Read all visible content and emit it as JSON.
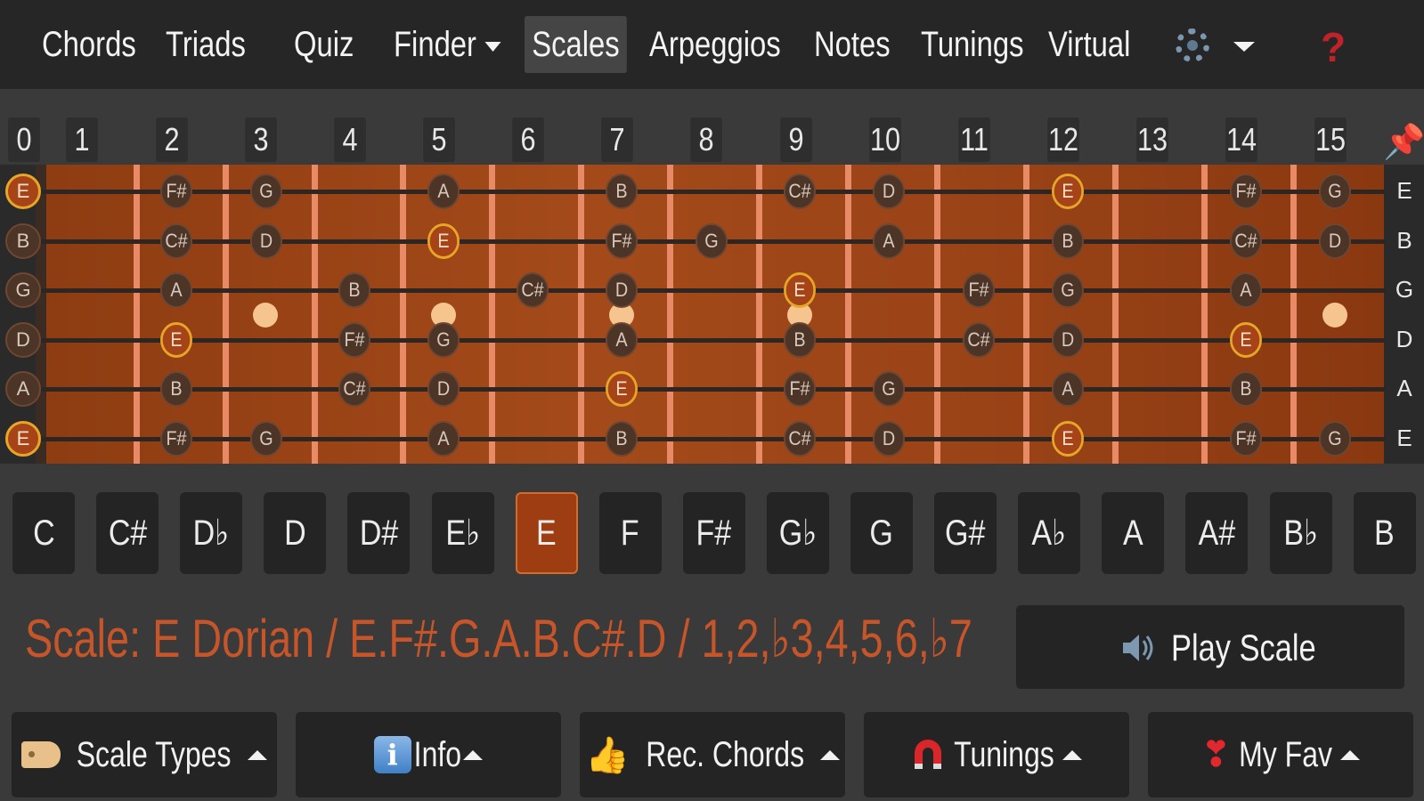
{
  "nav": {
    "items": [
      "Chords",
      "Triads",
      "Quiz",
      "Finder",
      "Scales",
      "Arpeggios",
      "Notes",
      "Tunings",
      "Virtual"
    ],
    "active": "Scales",
    "help_label": "?"
  },
  "fret_numbers": [
    "0",
    "1",
    "2",
    "3",
    "4",
    "5",
    "6",
    "7",
    "8",
    "9",
    "10",
    "11",
    "12",
    "13",
    "14",
    "15"
  ],
  "strings": [
    {
      "open": "E",
      "root": true,
      "notes": [
        null,
        "F#",
        "G",
        null,
        "A",
        null,
        "B",
        null,
        "C#",
        "D",
        null,
        "E",
        null,
        "F#",
        "G"
      ]
    },
    {
      "open": "B",
      "root": false,
      "notes": [
        null,
        "C#",
        "D",
        null,
        "E",
        null,
        "F#",
        "G",
        null,
        "A",
        null,
        "B",
        null,
        "C#",
        "D"
      ]
    },
    {
      "open": "G",
      "root": false,
      "notes": [
        null,
        "A",
        null,
        "B",
        null,
        "C#",
        "D",
        null,
        "E",
        null,
        "F#",
        "G",
        null,
        "A",
        null
      ]
    },
    {
      "open": "D",
      "root": false,
      "notes": [
        null,
        "E",
        null,
        "F#",
        "G",
        null,
        "A",
        null,
        "B",
        null,
        "C#",
        "D",
        null,
        "E",
        null
      ]
    },
    {
      "open": "A",
      "root": false,
      "notes": [
        null,
        "B",
        null,
        "C#",
        "D",
        null,
        "E",
        null,
        "F#",
        "G",
        null,
        "A",
        null,
        "B",
        null
      ]
    },
    {
      "open": "E",
      "root": true,
      "notes": [
        null,
        "F#",
        "G",
        null,
        "A",
        null,
        "B",
        null,
        "C#",
        "D",
        null,
        "E",
        null,
        "F#",
        "G"
      ]
    }
  ],
  "string_labels": [
    "E",
    "B",
    "G",
    "D",
    "A",
    "E"
  ],
  "root_note": "E",
  "keys": [
    "C",
    "C#",
    "D♭",
    "D",
    "D#",
    "E♭",
    "E",
    "F",
    "F#",
    "G♭",
    "G",
    "G#",
    "A♭",
    "A",
    "A#",
    "B♭",
    "B"
  ],
  "selected_key": "E",
  "scale_line": "Scale: E Dorian / E.F#.G.A.B.C#.D / 1,2,♭3,4,5,6,♭7",
  "play_button": "Play Scale",
  "tabs": [
    {
      "label": "Scale Types",
      "icon": "tag-icon"
    },
    {
      "label": "Info",
      "icon": "info-icon"
    },
    {
      "label": "Rec. Chords",
      "icon": "thumbs-up-icon"
    },
    {
      "label": "Tunings",
      "icon": "magnet-icon"
    },
    {
      "label": "My Fav",
      "icon": "heart-icon"
    }
  ],
  "colors": {
    "accent": "#c6552a",
    "fretboard": "#9a4317",
    "root_ring": "#e6a728",
    "help": "#c0222a"
  }
}
